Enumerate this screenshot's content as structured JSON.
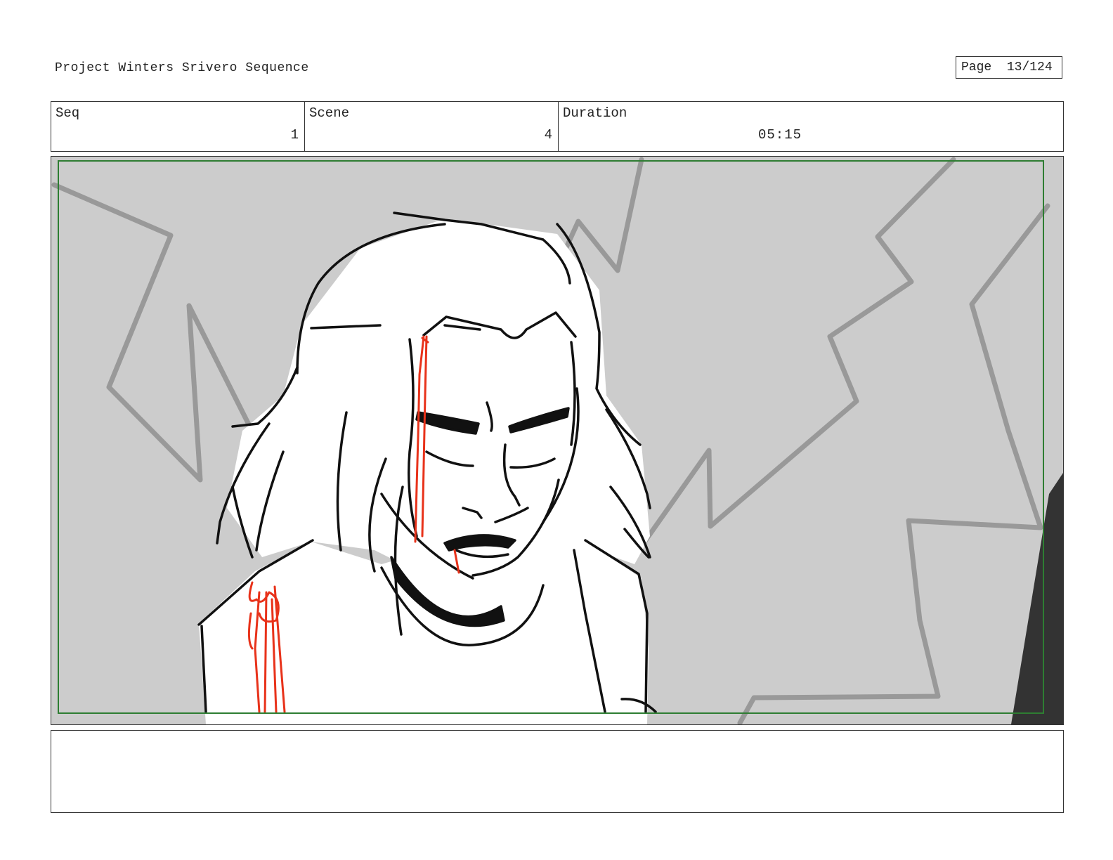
{
  "header": {
    "project_title": "Project Winters Srivero Sequence",
    "page_label": "Page",
    "page_number": "13/124"
  },
  "info": {
    "seq_label": "Seq",
    "seq_value": "1",
    "scene_label": "Scene",
    "scene_value": "4",
    "duration_label": "Duration",
    "duration_value": "05:15"
  },
  "panel": {
    "background_color": "#cccccc",
    "safe_frame_color": "#2e7d32",
    "blood_color": "#e8321a",
    "line_color": "#111111",
    "bg_stroke_color": "#999999"
  },
  "notes": {
    "text": ""
  }
}
